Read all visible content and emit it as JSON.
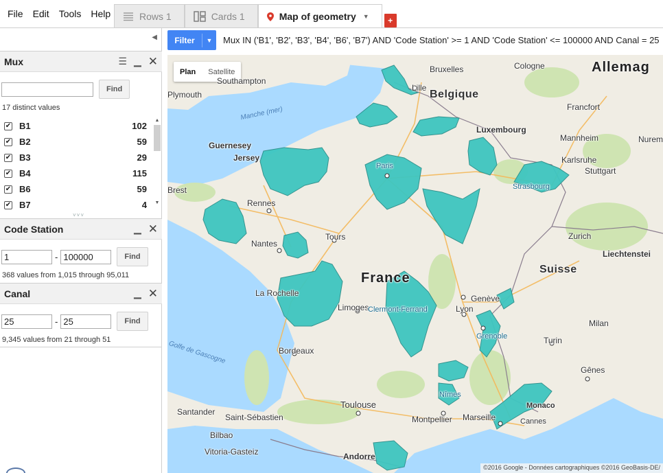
{
  "menu": [
    "File",
    "Edit",
    "Tools",
    "Help"
  ],
  "tabs": [
    {
      "label": "Rows 1",
      "icon": "rows-icon",
      "active": false
    },
    {
      "label": "Cards 1",
      "icon": "cards-icon",
      "active": false
    },
    {
      "label": "Map of geometry",
      "icon": "map-pin-icon",
      "active": true
    }
  ],
  "add_tab_label": "+",
  "filter": {
    "button_label": "Filter",
    "expression": "Mux IN ('B1', 'B2', 'B3', 'B4', 'B6', 'B7') AND 'Code Station' >= 1 AND 'Code Station' <= 100000 AND Canal = 25"
  },
  "facets": {
    "mux": {
      "title": "Mux",
      "search_value": "",
      "find_label": "Find",
      "summary": "17 distinct values",
      "items": [
        {
          "name": "B1",
          "count": "102",
          "checked": true
        },
        {
          "name": "B2",
          "count": "59",
          "checked": true
        },
        {
          "name": "B3",
          "count": "29",
          "checked": true
        },
        {
          "name": "B4",
          "count": "115",
          "checked": true
        },
        {
          "name": "B6",
          "count": "59",
          "checked": true
        },
        {
          "name": "B7",
          "count": "4",
          "checked": true
        }
      ]
    },
    "code_station": {
      "title": "Code Station",
      "min": "1",
      "max": "100000",
      "find_label": "Find",
      "summary": "368 values from 1,015 through 95,011"
    },
    "canal": {
      "title": "Canal",
      "min": "25",
      "max": "25",
      "find_label": "Find",
      "summary": "9,345 values from 21 through 51"
    }
  },
  "map": {
    "type_buttons": [
      "Plan",
      "Satellite"
    ],
    "active_type": "Plan",
    "attribution": "©2016 Google - Données cartographiques ©2016 GeoBasis-DE/",
    "polygon_color": "#3ec6c0",
    "labels": {
      "allemagne": "Allemag",
      "belgique": "Belgique",
      "luxembourg": "Luxembourg",
      "france": "France",
      "suisse": "Suisse",
      "monaco": "Monaco",
      "liechtenstein": "Liechtenstei",
      "andorre": "Andorre",
      "guernesey": "Guernesey",
      "jersey": "Jersey",
      "manche": "Manche (mer)",
      "gascogne": "Golfe de Gascogne",
      "bruxelles": "Bruxelles",
      "cologne": "Cologne",
      "lille": "Lille",
      "southampton": "Southampton",
      "plymouth": "Plymouth",
      "francfort": "Francfort",
      "mannheim": "Mannheim",
      "karlsruhe": "Karlsruhe",
      "stuttgart": "Stuttgart",
      "nuremberg": "Nurem",
      "strasbourg": "Strasbourg",
      "paris": "Paris",
      "brest": "Brest",
      "rennes": "Rennes",
      "nantes": "Nantes",
      "tours": "Tours",
      "zurich": "Zurich",
      "larochelle": "La Rochelle",
      "limoges": "Limoges",
      "clermont": "Clermont-Ferrand",
      "geneve": "Genève",
      "lyon": "Lyon",
      "milan": "Milan",
      "grenoble": "Grenoble",
      "turin": "Turin",
      "bordeaux": "Bordeaux",
      "genes": "Gênes",
      "nimes": "Nîmes",
      "toulouse": "Toulouse",
      "montpellier": "Montpellier",
      "marseille": "Marseille",
      "cannes": "Cannes",
      "santander": "Santander",
      "sansebastian": "Saint-Sébastien",
      "bilbao": "Bilbao",
      "vitoria": "Vitoria-Gasteiz"
    }
  }
}
